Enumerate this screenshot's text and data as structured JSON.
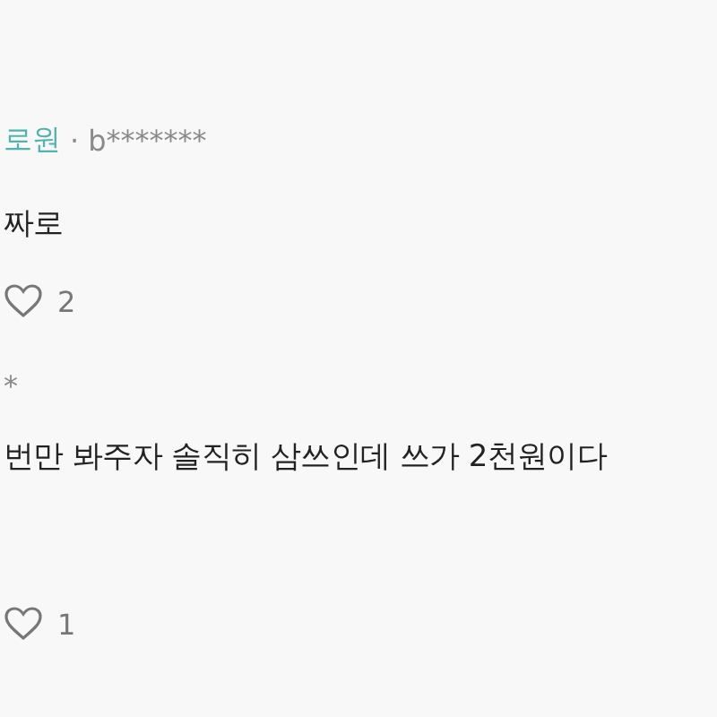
{
  "comments": [
    {
      "author": "로원",
      "separator": "·",
      "user_id": "b*******",
      "text": "짜로",
      "likes": "2"
    },
    {
      "user_id": "*",
      "text": "번만 봐주자 솔직히 삼쓰인데 쓰가 2천원이다",
      "likes": "1"
    }
  ]
}
